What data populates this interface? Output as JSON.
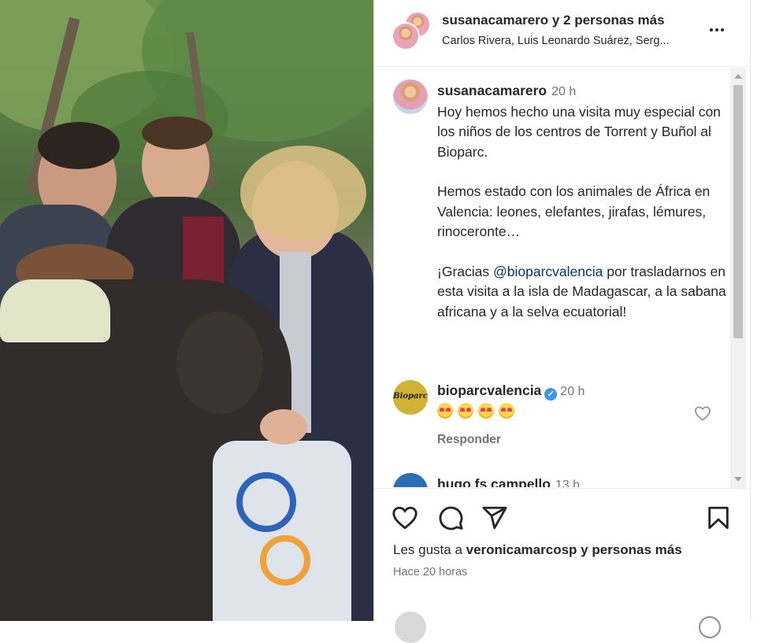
{
  "header": {
    "title": "susanacamarero y 2 personas más",
    "subtitle": "Carlos Rivera, Luis Leonardo Suárez, Serg..."
  },
  "post": {
    "username": "susanacamarero",
    "time": "20 h",
    "paragraphs": [
      "Hoy hemos hecho una visita muy especial con los niños de los centros de Torrent y Buñol al Bioparc.",
      "Hemos estado con los animales de África en Valencia: leones, elefantes, jirafas, lémures, rinoceronte…"
    ],
    "para3_before": "¡Gracias ",
    "para3_mention": "@bioparcvalencia",
    "para3_after": " por trasladarnos en esta visita a la isla de Madagascar, a la sabana africana y a la selva ecuatorial!"
  },
  "comments": [
    {
      "username": "bioparcvalencia",
      "time": "20 h",
      "avatar_text": "Bioparc",
      "reply_label": "Responder",
      "emoji_count": 4
    },
    {
      "username": "hugo fs campello",
      "time": "13 h"
    }
  ],
  "actions": {
    "likes_prefix": "Les gusta a ",
    "likes_user": "veronicamarcosp",
    "likes_suffix": " y personas más",
    "ago": "Hace 20 horas"
  },
  "icons": [
    "more-icon",
    "heart-icon",
    "comment-icon",
    "share-icon",
    "bookmark-icon",
    "verified-icon"
  ],
  "colors": {
    "accent": "#3897f0",
    "mention": "#00376b",
    "muted": "#737373",
    "text": "#262626"
  }
}
